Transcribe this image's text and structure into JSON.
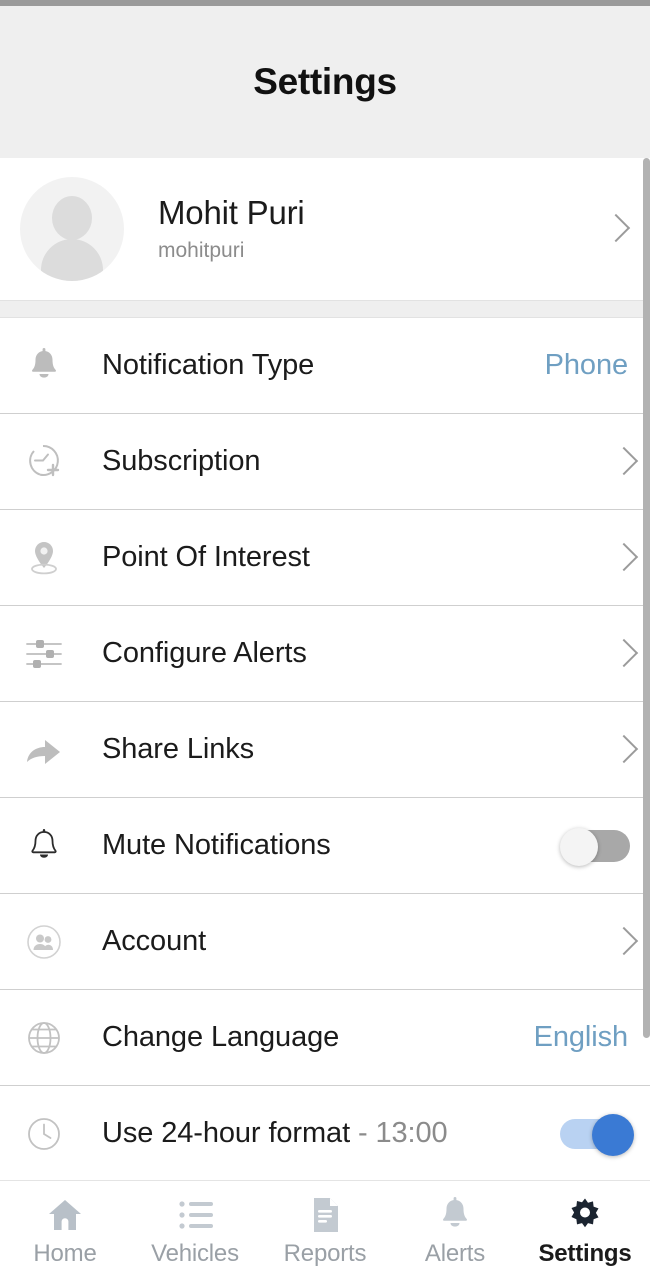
{
  "header": {
    "title": "Settings"
  },
  "profile": {
    "name": "Mohit Puri",
    "handle": "mohitpuri",
    "avatar_icon": "person-placeholder-icon",
    "chevron_icon": "chevron-right-icon"
  },
  "settings_rows": [
    {
      "label": "Notification Type",
      "icon": "bell-filled-icon",
      "value": "Phone",
      "control": "value"
    },
    {
      "label": "Subscription",
      "icon": "clock-plus-icon",
      "value": "",
      "control": "chevron"
    },
    {
      "label": "Point Of Interest",
      "icon": "map-pin-icon",
      "value": "",
      "control": "chevron"
    },
    {
      "label": "Configure Alerts",
      "icon": "sliders-icon",
      "value": "",
      "control": "chevron"
    },
    {
      "label": "Share Links",
      "icon": "share-arrow-icon",
      "value": "",
      "control": "chevron"
    },
    {
      "label": "Mute Notifications",
      "icon": "bell-outline-icon",
      "value": "",
      "control": "toggle",
      "toggle_state": "off"
    },
    {
      "label": "Account",
      "icon": "users-circle-icon",
      "value": "",
      "control": "chevron"
    },
    {
      "label": "Change Language",
      "icon": "globe-icon",
      "value": "English",
      "control": "value"
    },
    {
      "label": "Use 24-hour format",
      "label_suffix": " - 13:00",
      "icon": "clock-icon",
      "value": "",
      "control": "toggle",
      "toggle_state": "on"
    }
  ],
  "bottom_nav": {
    "items": [
      {
        "label": "Home",
        "icon": "home-icon",
        "active": false
      },
      {
        "label": "Vehicles",
        "icon": "list-icon",
        "active": false
      },
      {
        "label": "Reports",
        "icon": "document-icon",
        "active": false
      },
      {
        "label": "Alerts",
        "icon": "bell-icon",
        "active": false
      },
      {
        "label": "Settings",
        "icon": "gear-icon",
        "active": true
      }
    ]
  },
  "colors": {
    "header_bg": "#efefef",
    "link_blue": "#6f9fc2",
    "toggle_on": "#3a7ad4",
    "toggle_on_track": "#b9d2f2",
    "toggle_off": "#a8a8a8",
    "icon_gray": "#b9b9b9",
    "text_primary": "#1b1b1b",
    "nav_inactive": "#9aa0a6"
  }
}
